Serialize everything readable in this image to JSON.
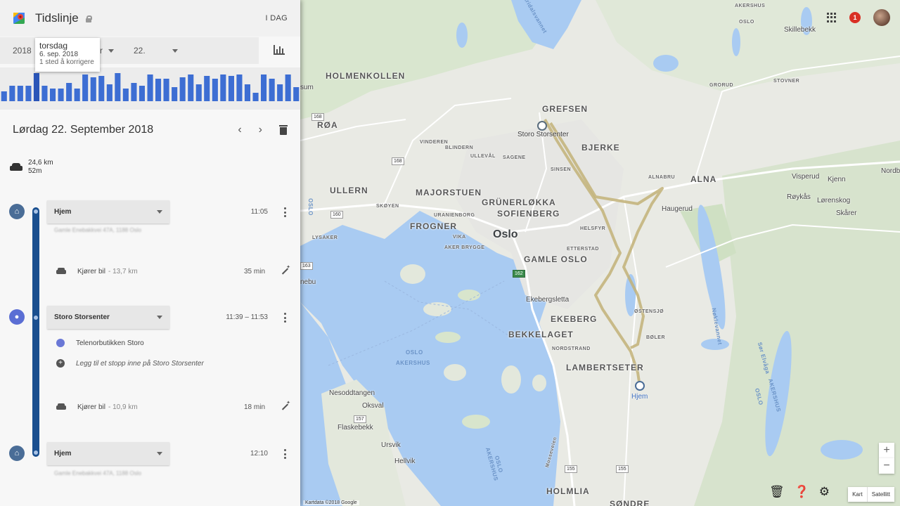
{
  "header": {
    "title": "Tidslinje",
    "today": "I DAG"
  },
  "date_select": {
    "year": "2018",
    "month_fragment": "er",
    "day": "22."
  },
  "tooltip": {
    "day": "torsdag",
    "date": "6. sep. 2018",
    "fix": "1 sted å korrigere"
  },
  "histogram": {
    "values": [
      0.35,
      0.55,
      0.55,
      0.55,
      1.0,
      0.55,
      0.45,
      0.45,
      0.65,
      0.45,
      0.95,
      0.85,
      0.9,
      0.6,
      1.0,
      0.45,
      0.65,
      0.55,
      0.95,
      0.8,
      0.8,
      0.5,
      0.85,
      0.95,
      0.6,
      0.9,
      0.8,
      0.95,
      0.9,
      0.95,
      0.6,
      0.3,
      0.95,
      0.8,
      0.6,
      0.95,
      0.5
    ],
    "selected_index": 4
  },
  "day": {
    "title": "Lørdag 22. September 2018"
  },
  "summary": {
    "distance": "24,6 km",
    "duration": "52m"
  },
  "stops": [
    {
      "name": "Hjem",
      "time": "11:05",
      "address": "Gamle Enebakkvei 47A, 1188 Oslo"
    },
    {
      "name": "Storo Storsenter",
      "time": "11:39 – 11:53",
      "sub_place": "Telenorbutikken Storo",
      "add_stop": "Legg til et stopp inne på Storo Storsenter"
    },
    {
      "name": "Hjem",
      "time": "12:10",
      "address": "Gamle Enebakkvei 47A, 1188 Oslo"
    }
  ],
  "drives": [
    {
      "label": "Kjører bil",
      "distance": "- 13,7 km",
      "duration": "35 min"
    },
    {
      "label": "Kjører bil",
      "distance": "- 10,9 km",
      "duration": "18 min"
    }
  ],
  "map": {
    "labels": {
      "holmenkollen": "HOLMENKOLLEN",
      "grefsen": "GREFSEN",
      "roa": "RØA",
      "bjerke": "BJERKE",
      "ullern": "ULLERN",
      "majorstuen": "MAJORSTUEN",
      "grunerlokka": "GRÜNERLØKKA",
      "sofienberg": "SOFIENBERG",
      "alna": "ALNA",
      "frogner": "FROGNER",
      "oslo": "Oslo",
      "gamle_oslo": "GAMLE OSLO",
      "ekebergsletta": "Ekebergsletta",
      "ekeberg": "EKEBERG",
      "bekkelaget": "BEKKELAGET",
      "lambertseter": "LAMBERTSETER",
      "holmlia": "HOLMLIA",
      "sondre": "SØNDRE",
      "nesoddtangen": "Nesoddtangen",
      "oksval": "Oksval",
      "flaskebekk": "Flaskebekk",
      "ursvik": "Ursvik",
      "hellvik": "Hellvik",
      "storo": "Storo Storsenter",
      "hjem": "Hjem",
      "vinderen": "VINDEREN",
      "blindern": "BLINDERN",
      "ullevaal": "ULLEVÅL",
      "sagene": "SAGENE",
      "sinsen": "SINSEN",
      "skoyen": "SKØYEN",
      "uranienborg": "URANIENBORG",
      "vika": "VIKA",
      "aker_brygge": "AKER BRYGGE",
      "lysaker": "LYSAKER",
      "helsfyr": "HELSFYR",
      "etterstad": "ETTERSTAD",
      "ostensjo": "ØSTENSJØ",
      "boler": "BØLER",
      "nordstrand": "NORDSTRAND",
      "alnabru": "ALNABRU",
      "haugerud": "Haugerud",
      "visperud": "Visperud",
      "kjenn": "Kjenn",
      "royktas": "Røykås",
      "lorenskog": "Lørenskog",
      "skarer": "Skårer",
      "nordb": "Nordb",
      "skillebekk": "Skillebekk",
      "akershus_top": "AKERSHUS",
      "oslo_top": "OSLO",
      "grorud": "GRORUD",
      "stovner": "STOVNER",
      "sum": "sum",
      "nebu": "nebu",
      "maridalsvannet": "Maridalsvannet",
      "oslo_water": "OSLO",
      "akershus_water": "AKERSHUS",
      "nokkelvannet": "Nøklevannet",
      "sor_elvaga": "Sør Elvåga",
      "akershus_right": "AKERSHUS",
      "oslo_right": "OSLO",
      "oslo_left": "OSLO",
      "oslo_bottom": "OSLO",
      "akershus_bottom": "AKERSHUS",
      "mosseveien": "Mosseveien"
    },
    "road_badges": {
      "r168a": "168",
      "r168b": "168",
      "r160": "160",
      "r162": "162",
      "r157": "157",
      "r155a": "155",
      "r155b": "155",
      "r163": "163"
    },
    "controls": {
      "zoom_in": "+",
      "zoom_out": "−",
      "map_type": "Kart",
      "satellite": "Satellitt"
    },
    "copyright": "Kartdata ©2018 Google",
    "notifications": "1"
  },
  "colors": {
    "route": "#c2b278",
    "water": "#a9cbf2",
    "panel": "#f7f7f7",
    "timeline": "#1a4f8f",
    "bars": "#3d6ed3"
  }
}
